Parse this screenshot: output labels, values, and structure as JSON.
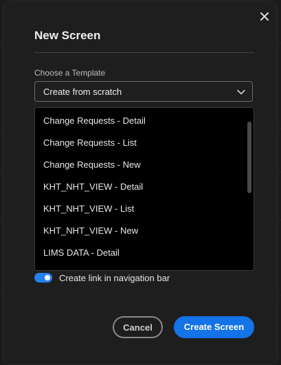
{
  "dialog": {
    "title": "New Screen",
    "close_icon": "close-icon"
  },
  "template": {
    "label": "Choose a Template",
    "selected": "Create from scratch",
    "chevron_icon": "chevron-down-icon",
    "options": [
      "Change Requests - Detail",
      "Change Requests - List",
      "Change Requests - New",
      "KHT_NHT_VIEW - Detail",
      "KHT_NHT_VIEW - List",
      "KHT_NHT_VIEW - New",
      "LIMS DATA - Detail"
    ]
  },
  "nav_link": {
    "label": "Create link in navigation bar",
    "enabled": true
  },
  "footer": {
    "cancel_label": "Cancel",
    "create_label": "Create Screen"
  },
  "colors": {
    "accent": "#1473e6",
    "toggle": "#2680eb",
    "background": "#1e1e1e",
    "dropdown_bg": "#000000"
  }
}
